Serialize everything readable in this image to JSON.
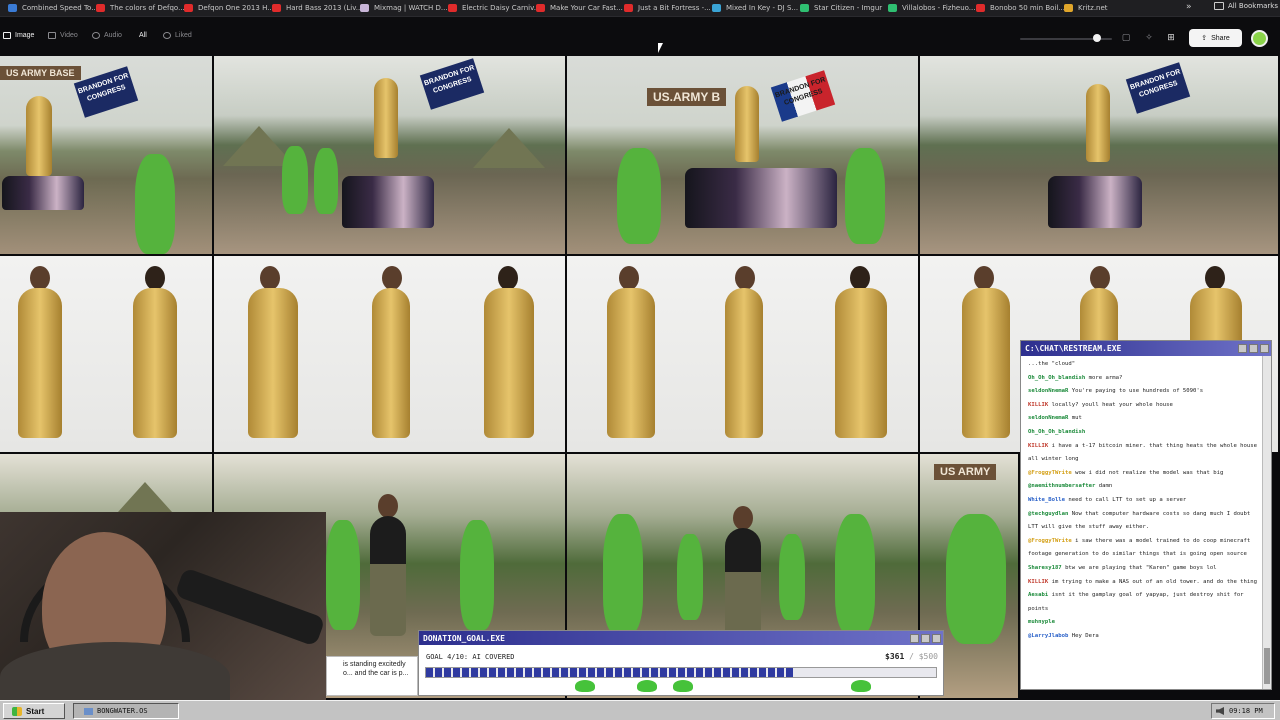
{
  "bookmarks": {
    "items": [
      {
        "label": "Combined Speed To...",
        "color": "#3a7bd5"
      },
      {
        "label": "The colors of Defqo...",
        "color": "#e02b2b"
      },
      {
        "label": "Defqon One 2013 H...",
        "color": "#e02b2b"
      },
      {
        "label": "Hard Bass 2013 (Liv...",
        "color": "#e02b2b"
      },
      {
        "label": "Mixmag | WATCH D...",
        "color": "#c9b6d8"
      },
      {
        "label": "Electric Daisy Carniv...",
        "color": "#e02b2b"
      },
      {
        "label": "Make Your Car Fast...",
        "color": "#e02b2b"
      },
      {
        "label": "Just a Bit Fortress -...",
        "color": "#e02b2b"
      },
      {
        "label": "Mixed In Key - DJ S...",
        "color": "#3aa4d5"
      },
      {
        "label": "Star Citizen - Imgur",
        "color": "#2fbf71"
      },
      {
        "label": "Villalobos - Fizheuo...",
        "color": "#2fbf71"
      },
      {
        "label": "Bonobo 50 min Boil...",
        "color": "#e02b2b"
      },
      {
        "label": "Kritz.net",
        "color": "#e0a62b"
      }
    ],
    "more": "»",
    "all_bookmarks": "All Bookmarks"
  },
  "toolbar": {
    "tabs": [
      {
        "label": "Image",
        "active": true
      },
      {
        "label": "Video",
        "active": false
      },
      {
        "label": "Audio",
        "active": false
      },
      {
        "label": "All",
        "active": true
      },
      {
        "label": "Liked",
        "active": false
      }
    ],
    "share_label": "Share"
  },
  "chat": {
    "title": "C:\\CHAT\\RESTREAM.EXE",
    "messages": [
      {
        "user": "",
        "text": "...the \"cloud\"",
        "color": "#222"
      },
      {
        "user": "Oh_Oh_Oh_blandish",
        "text": "more arma?",
        "color": "#1b8a3a"
      },
      {
        "user": "seldonNnemaR",
        "text": "You're paying to use hundreds of 5090's",
        "color": "#1b8a3a"
      },
      {
        "user": "KILLIK",
        "text": "locally? youll heat your whole house",
        "color": "#c0392b"
      },
      {
        "user": "seldonNnemaR",
        "text": "mut",
        "color": "#1b8a3a"
      },
      {
        "user": "Oh_Oh_Oh_blandish",
        "text": "",
        "color": "#1b8a3a"
      },
      {
        "user": "KILLIK",
        "text": "i have a t-17 bitcoin miner. that thing heats the whole house all winter long",
        "color": "#c0392b"
      },
      {
        "user": "@FroggyTWrite",
        "text": "wow i did not realize the model was that big",
        "color": "#d4a017"
      },
      {
        "user": "@naemithnumbersafter",
        "text": "damn",
        "color": "#1b8a3a"
      },
      {
        "user": "White_Bolle",
        "text": "need to call LTT to set up a server",
        "color": "#2b62c9"
      },
      {
        "user": "@techguydlan",
        "text": "Now that computer hardware costs so dang much I doubt LTT will give the stuff away either.",
        "color": "#1b8a3a"
      },
      {
        "user": "@FroggyTWrite",
        "text": "i saw there was a model trained to do coop minecraft footage generation to do similar things that is going open source",
        "color": "#d4a017"
      },
      {
        "user": "Sharesy187",
        "text": "btw we are playing that \"Karen\" game boys lol",
        "color": "#1b8a3a"
      },
      {
        "user": "KILLIK",
        "text": "im trying to make a NAS out of an old tower. and do the thing",
        "color": "#c0392b"
      },
      {
        "user": "Aesabi",
        "text": "isnt it the gamplay goal of yapyap, just destroy shit for points",
        "color": "#1b8a3a"
      },
      {
        "user": "muhnyple",
        "text": "",
        "color": "#1b8a3a"
      },
      {
        "user": "@LarryJlabob",
        "text": "Hey Dera",
        "color": "#2b62c9"
      }
    ]
  },
  "donation": {
    "title": "DONATION_GOAL.EXE",
    "goal_label": "GOAL 4/10: AI COVERED",
    "amount": "$361",
    "target": "/ $500",
    "progress": 0.72
  },
  "caption": {
    "text": "is standing excitedly o... and the car is p..."
  },
  "taskbar": {
    "start_label": "Start",
    "task_label": "BONGWATER.OS",
    "clock": "09:18 PM"
  },
  "gallery": {
    "tiles": [
      {
        "name": "camp-flag-1",
        "sign": "US ARMY BASE",
        "flag": "BRANDON FOR CONGRESS",
        "car_plate": "FLESHLIGHT"
      },
      {
        "name": "camp-flag-2",
        "flag": "BRANDON FOR CONGRESS",
        "car_plate": "FLESHLIGHT"
      },
      {
        "name": "camp-flag-3",
        "sign": "US.ARMY B",
        "flag": "BRANDON FOR CONGRESS",
        "car_plate": "FLESHLIGHT"
      },
      {
        "name": "camp-flag-4",
        "flag": "BRANDON FOR CONGRESS",
        "car_plate": "FLESHLIGHT"
      },
      {
        "name": "robe-turnaround-1"
      },
      {
        "name": "robe-turnaround-2"
      },
      {
        "name": "robe-turnaround-3"
      },
      {
        "name": "robe-turnaround-4"
      },
      {
        "name": "jungle-frogs-1"
      },
      {
        "name": "jungle-frogs-2"
      },
      {
        "name": "jungle-frogs-3"
      },
      {
        "name": "jungle-frogs-4",
        "sign": "US ARMY"
      }
    ]
  }
}
